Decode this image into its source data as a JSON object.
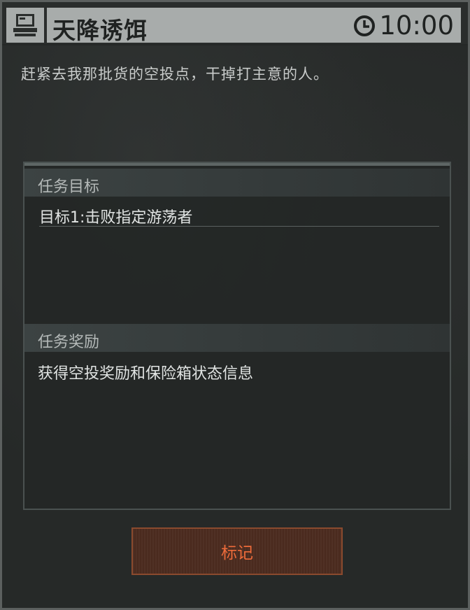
{
  "mission": {
    "title": "天降诱饵",
    "timer": "10:00",
    "description": "赶紧去我那批货的空投点，干掉打主意的人。",
    "objectives_header": "任务目标",
    "objective_1": "目标1:击败指定游荡者",
    "rewards_header": "任务奖励",
    "reward_text": "获得空投奖励和保险箱状态信息",
    "mark_button": "标记"
  },
  "icons": {
    "mission_icon": "computer-terminal-icon",
    "timer_icon": "clock-icon"
  },
  "colors": {
    "accent": "#ee6b3a",
    "button_border": "#8b4a2e",
    "title_bar": "#a8acab"
  }
}
